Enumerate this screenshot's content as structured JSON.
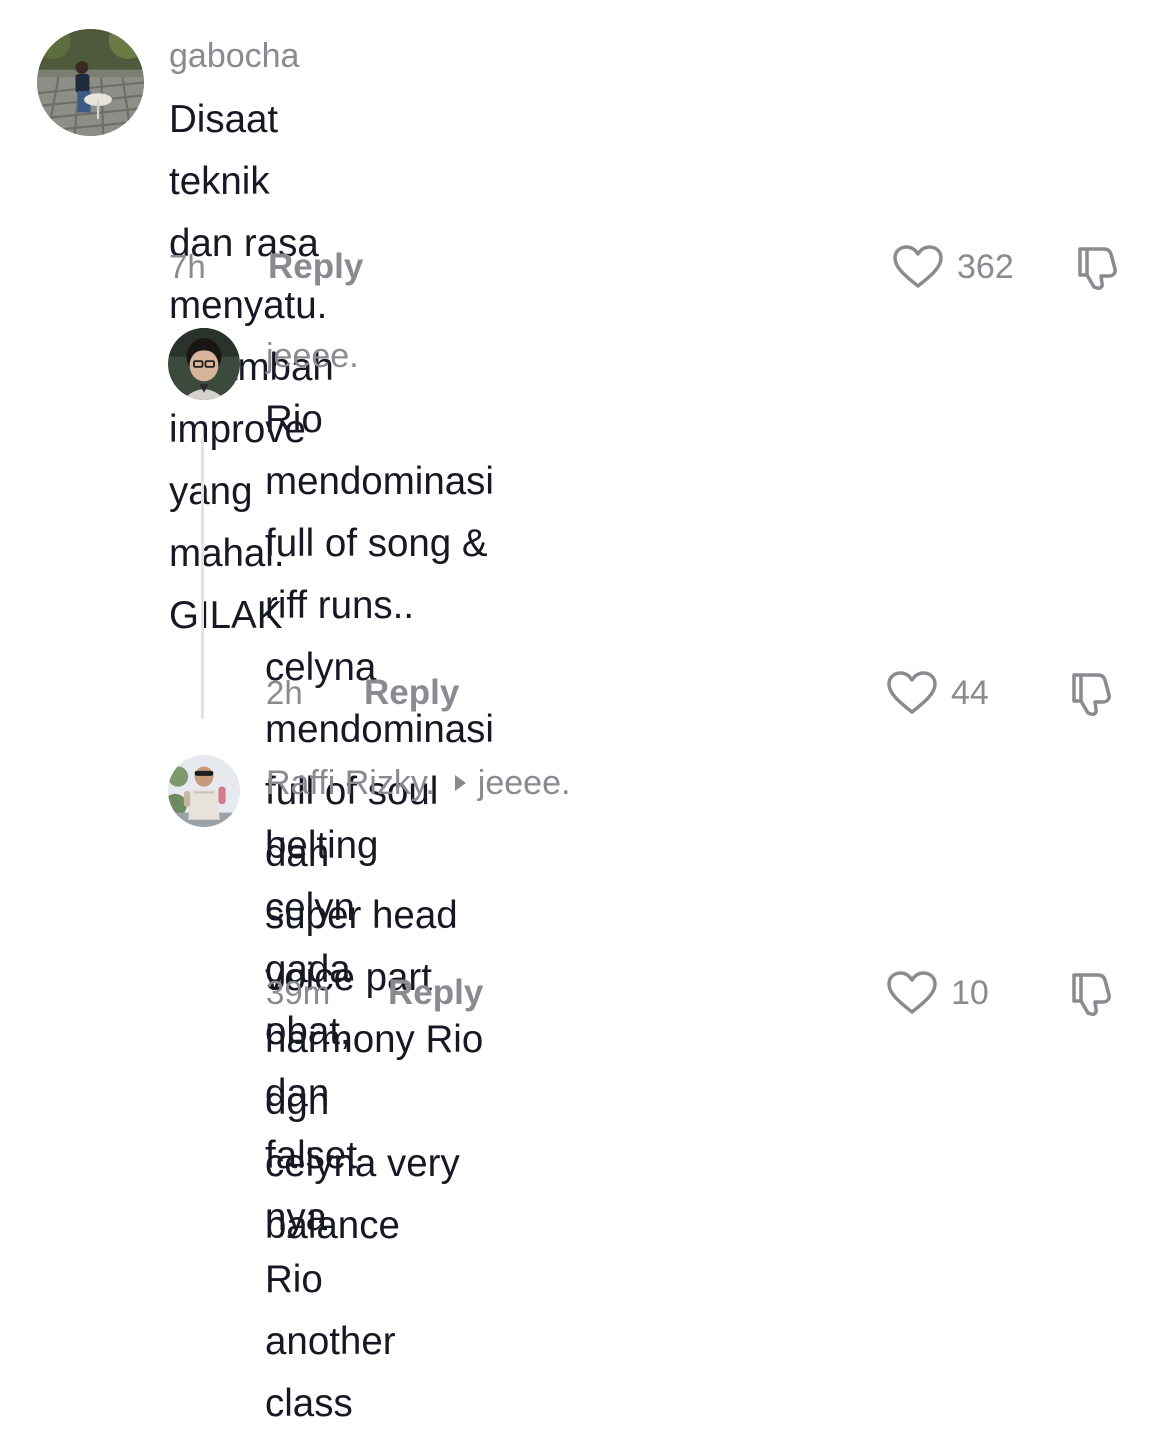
{
  "comments": [
    {
      "username": "gabocha",
      "text": "Disaat teknik dan rasa menyatu. Ditambah\nimprove yang mahal. GILAK",
      "time": "7h",
      "reply_label": "Reply",
      "likes": "362"
    },
    {
      "username": "jeeee.",
      "text": "Rio mendominasi full of song & riff runs..\ncelyna mendominasi full of soul dan\nsuper head voice part harmony Rio dgn\ncelyna very balance",
      "time": "2h",
      "reply_label": "Reply",
      "likes": "44"
    },
    {
      "username": "Raffi Rizky.",
      "reply_to": "jeeee.",
      "text": "belting celyn gada obat, dan falset nya\nRio another class",
      "time": "39m",
      "reply_label": "Reply",
      "likes": "10"
    }
  ],
  "icons": {
    "like": "heart-outline-icon",
    "dislike": "thumbs-down-outline-icon",
    "reply_arrow": "triangle-right-icon"
  },
  "colors": {
    "secondary_text": "#8a8b91",
    "primary_text": "#161823",
    "thread_line": "#e3e3e5"
  }
}
